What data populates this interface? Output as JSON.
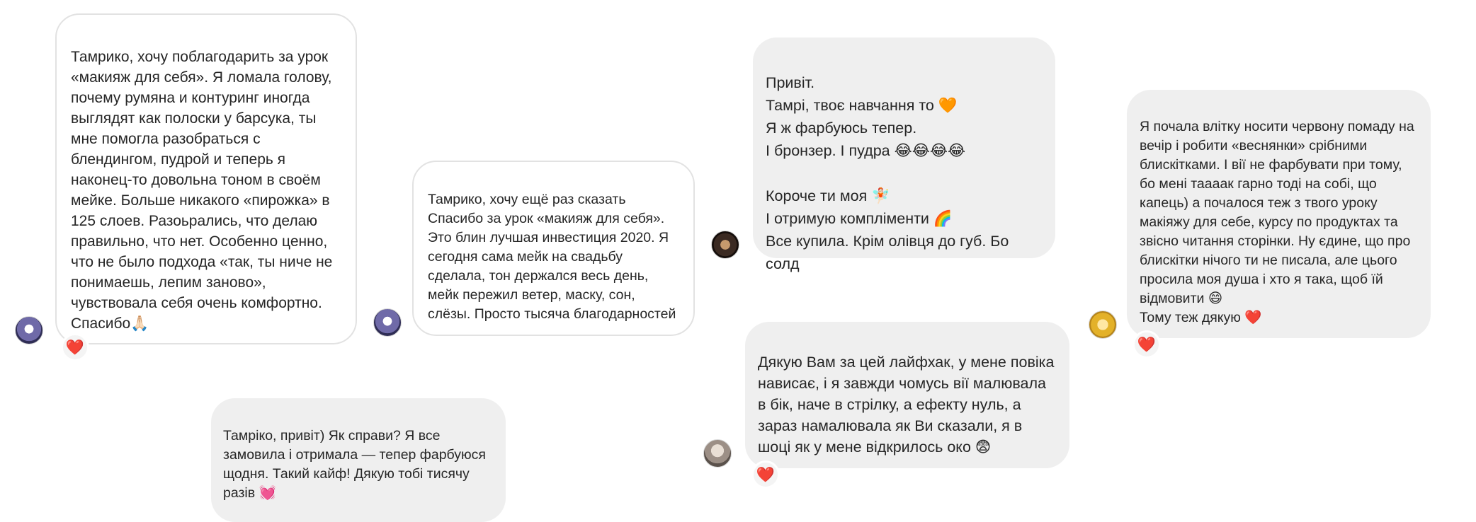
{
  "messages": [
    {
      "text": "Тамрико, хочу поблагодарить за урок «макияж для себя». Я ломала голову, почему румяна и контуринг иногда выглядят как полоски у барсука, ты мне помогла разобраться с блендингом, пудрой и теперь я наконец-то довольна тоном в своём мейке. Больше никакого «пирожка» в 125 слоев. Разоьрались, что делаю правильно, что нет. Особенно ценно, что не было подхода «так, ты ниче не понимаешь, лепим заново», чувствовала себя очень комфортно. Спасибо🙏🏻",
      "reaction": "❤️"
    },
    {
      "text": "Тамрико, хочу ещё раз сказать Спасибо за урок «макияж для себя». Это блин лучшая инвестиция 2020. Я сегодня сама мейк на свадьбу сделала, тон держался весь день, мейк пережил ветер, маску, сон, слёзы. Просто тысяча благодарностей"
    },
    {
      "text": "Тамріко, привіт) Як справи? Я все замовила і отримала — тепер фарбуюся щодня. Такий кайф! Дякую тобі тисячу разів 💓"
    },
    {
      "text": "Привіт.\nТамрі, твоє навчання то 🧡\nЯ ж фарбуюсь тепер.\nІ бронзер. І пудра 😂😂😂😂\n\nКороче ти моя 🧚🏻\nІ отримую компліменти 🌈\nВсе купила. Крім олівця до губ. Бо солд"
    },
    {
      "text": "Дякую Вам за цей лайфхак, у мене повіка нависає, і я завжди чомусь вії малювала в бік, наче в стрілку, а ефекту нуль, а зараз намалювала як Ви сказали, я в шоці як у мене відкрилось око 😨",
      "reaction": "❤️"
    },
    {
      "text": "Я почала влітку носити червону помаду на вечір і робити «веснянки» срібними блискітками. І вії не фарбувати при тому, бо мені таааак гарно тоді на собі, що капець) а почалося теж з твого уроку макіяжу для себе, курсу по продуктах та звісно читання сторінки. Ну єдине, що про блискітки нічого ти не писала, але цього просила моя душа і хто я така, щоб їй відмовити 😄\nТому теж дякую ❤️",
      "reaction": "❤️"
    }
  ],
  "colors": {
    "bubble_grey": "#efefef",
    "bubble_white_border": "#e2e2e2",
    "text": "#262626",
    "heart": "#ed2b3c"
  }
}
